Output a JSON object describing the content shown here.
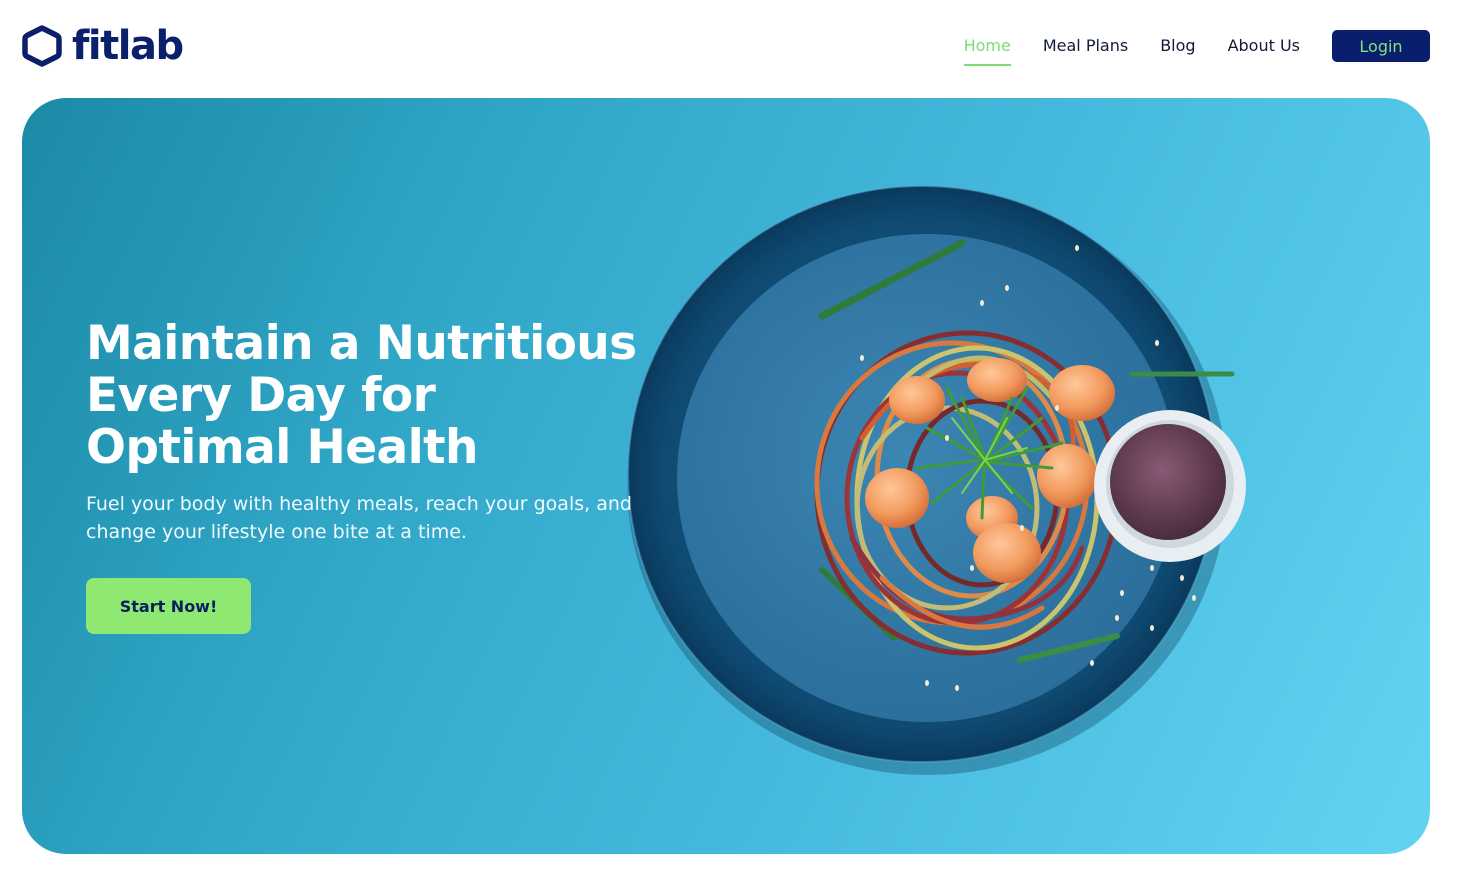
{
  "brand": {
    "name": "fitlab",
    "logo_icon": "hexagon-logo-icon",
    "color": "#0b1f6b"
  },
  "nav": {
    "items": [
      {
        "label": "Home",
        "active": true
      },
      {
        "label": "Meal Plans",
        "active": false
      },
      {
        "label": "Blog",
        "active": false
      },
      {
        "label": "About Us",
        "active": false
      }
    ],
    "login_label": "Login"
  },
  "hero": {
    "title": "Maintain a Nutritious Every Day for Optimal Health",
    "subtitle": "Fuel your body with healthy meals, reach your goals, and change your lifestyle one bite at a time.",
    "cta_label": "Start Now!",
    "image": "plate-of-shrimp-noodles-with-dipping-sauce"
  },
  "colors": {
    "accent_green": "#8ee872",
    "navy": "#0a1e6e",
    "hero_blue": "#45b9dd"
  }
}
